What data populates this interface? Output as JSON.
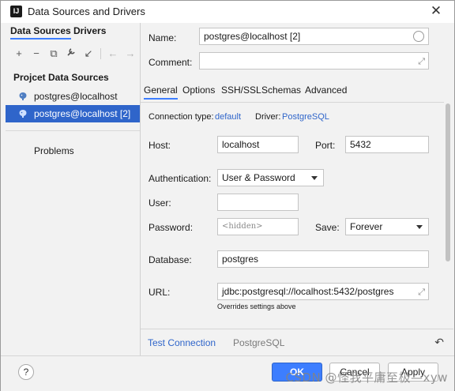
{
  "window": {
    "app_icon_text": "IJ",
    "title": "Data Sources and Drivers",
    "close_glyph": "✕"
  },
  "sidebar": {
    "tabs": [
      "Data Sources",
      "Drivers"
    ],
    "toolbar": [
      "+",
      "−",
      "⧉",
      "🔧",
      "↙",
      "←",
      "→"
    ],
    "section_label": "Projcet Data Sources",
    "items": [
      {
        "label": "postgres@localhost"
      },
      {
        "label": "postgres@localhost [2]"
      }
    ],
    "problems_label": "Problems"
  },
  "header": {
    "name_label": "Name:",
    "name_value": "postgres@localhost [2]",
    "comment_label": "Comment:",
    "comment_value": ""
  },
  "tabs": [
    "General",
    "Options",
    "SSH/SSL",
    "Schemas",
    "Advanced"
  ],
  "general": {
    "connection_type_label": "Connection type:",
    "connection_type_value": "default",
    "driver_label": "Driver:",
    "driver_value": "PostgreSQL",
    "host_label": "Host:",
    "host_value": "localhost",
    "port_label": "Port:",
    "port_value": "5432",
    "auth_label": "Authentication:",
    "auth_value": "User & Password",
    "user_label": "User:",
    "user_value": "",
    "password_label": "Password:",
    "password_placeholder": "<hidden>",
    "save_label": "Save:",
    "save_value": "Forever",
    "database_label": "Database:",
    "database_value": "postgres",
    "url_label": "URL:",
    "url_value": "jdbc:postgresql://localhost:5432/postgres",
    "url_note": "Overrides settings above"
  },
  "bottom": {
    "test_connection": "Test Connection",
    "driver_name": "PostgreSQL",
    "undo_glyph": "↶"
  },
  "footer": {
    "help": "?",
    "ok": "OK",
    "cancel": "Cancel",
    "apply": "Apply"
  },
  "watermark": "CSDN @怪我平庸至极—xyw",
  "colors": {
    "accent": "#3d7eff",
    "selection": "#2f65ca",
    "link": "#2f65ca"
  }
}
